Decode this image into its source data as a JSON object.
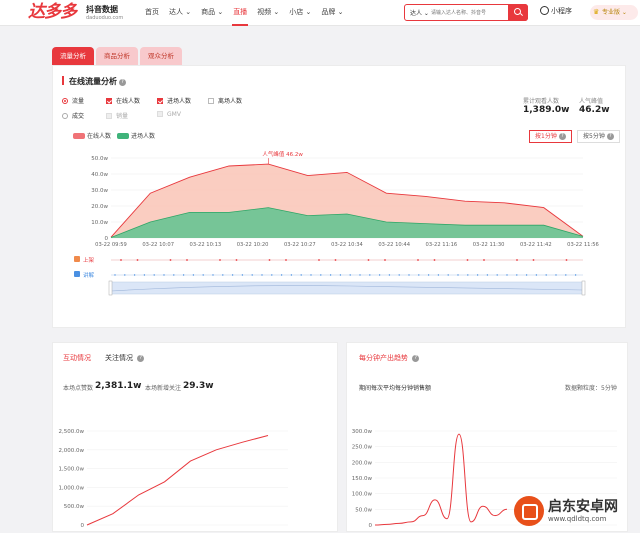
{
  "header": {
    "logo": "达多多",
    "logo_subtitle": "抖音数据",
    "logo_url": "daduoduo.com",
    "nav": [
      {
        "label": "首页",
        "active": false
      },
      {
        "label": "达人 ⌄",
        "active": false
      },
      {
        "label": "商品 ⌄",
        "active": false
      },
      {
        "label": "直播",
        "active": true
      },
      {
        "label": "视频 ⌄",
        "active": false
      },
      {
        "label": "小店 ⌄",
        "active": false
      },
      {
        "label": "品牌 ⌄",
        "active": false
      }
    ],
    "search_category": "达人 ⌄",
    "search_placeholder": "请输入达人名称、抖音号",
    "mini_program": "小程序",
    "pro_label": "专业版 ⌄"
  },
  "tabs": [
    "流量分析",
    "商品分析",
    "观众分析"
  ],
  "flow": {
    "title": "在线流量分析",
    "options": {
      "radio_flow": "流量",
      "radio_deal": "成交",
      "check_online": "在线人数",
      "check_enter": "进场人数",
      "check_leave": "离场人数",
      "check_sales": "销量",
      "check_gmv": "GMV"
    },
    "stats": {
      "total_label": "累计观看人数",
      "total_value": "1,389.0w",
      "peak_label": "人气峰值",
      "peak_value": "46.2w"
    },
    "legend": {
      "online": "在线人数",
      "enter": "进场人数"
    },
    "segment": {
      "one_min": "按1分钟",
      "five_min": "按5分钟"
    },
    "markers": {
      "on_shelf": "上架",
      "explain": "讲解"
    },
    "peak_annotation": "人气峰值 46.2w"
  },
  "interaction": {
    "tab_interact": "互动情况",
    "tab_follow": "关注情况",
    "likes_label": "本场点赞数",
    "likes_value": "2,381.1w",
    "follows_label": "本场新增关注",
    "follows_value": "29.3w"
  },
  "per_minute": {
    "title": "每分钟产出趋势",
    "subtitle": "期间每次平均每分钟销售额",
    "granularity": "数据颗粒度：5分钟"
  },
  "watermark": {
    "name": "启东安卓网",
    "url": "www.qdldtq.com"
  },
  "colors": {
    "accent": "#e8383d",
    "online_area": "#f5b0a0",
    "enter_area": "#5ec38f"
  },
  "chart_data": [
    {
      "type": "area",
      "title": "",
      "x": [
        "03-22 09:59",
        "03-22 10:07",
        "03-22 10:13",
        "03-22 10:20",
        "03-22 10:27",
        "03-22 10:34",
        "03-22 10:44",
        "03-22 11:16",
        "03-22 11:30",
        "03-22 11:42",
        "03-22 11:56"
      ],
      "ylim": [
        0,
        50
      ],
      "yticks": [
        "0",
        "10.0w",
        "20.0w",
        "30.0w",
        "40.0w",
        "50.0w"
      ],
      "series": [
        {
          "name": "在线人数",
          "color": "#f5a898",
          "values": [
            0.5,
            28,
            38,
            45,
            46.2,
            39,
            41,
            28,
            26,
            23,
            22,
            19,
            1
          ]
        },
        {
          "name": "进场人数",
          "color": "#5ec38f",
          "values": [
            0.3,
            10,
            16,
            16,
            19,
            14,
            15,
            10,
            9,
            8,
            8,
            8,
            1
          ]
        }
      ],
      "x_positions_count": 13
    },
    {
      "type": "line",
      "title": "",
      "ylim": [
        0,
        2500
      ],
      "yticks": [
        "0",
        "500.0w",
        "1,000.0w",
        "1,500.0w",
        "2,000.0w",
        "2,500.0w"
      ],
      "series": [
        {
          "name": "",
          "values": [
            0,
            300,
            800,
            1150,
            1700,
            2000,
            2200,
            2380
          ]
        }
      ]
    },
    {
      "type": "line",
      "title": "",
      "ylim": [
        0,
        300
      ],
      "yticks": [
        "0",
        "50.0w",
        "100.0w",
        "150.0w",
        "200.0w",
        "250.0w",
        "300.0w"
      ],
      "series": [
        {
          "name": "",
          "values": [
            0,
            2,
            5,
            10,
            30,
            80,
            20,
            290,
            10,
            60,
            30,
            50
          ]
        }
      ]
    }
  ]
}
